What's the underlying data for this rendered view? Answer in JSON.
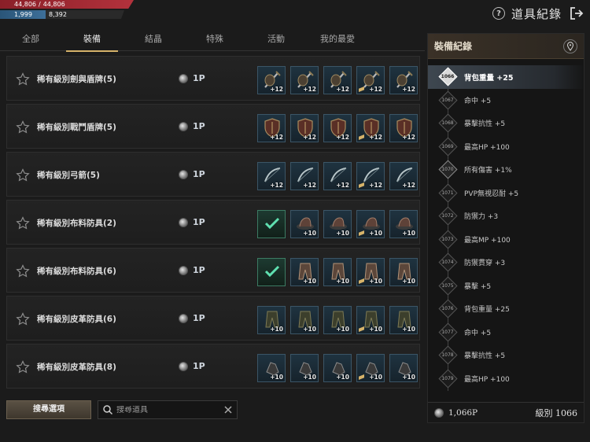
{
  "status": {
    "hp_current": "44,806",
    "hp_max": "44,806",
    "mp_current": "1,999",
    "mp_max": "8,392",
    "hp_color": "#b3323c",
    "mp_color": "#3d6f99",
    "mp_fill_fraction": 0.24
  },
  "header": {
    "title": "道具紀錄",
    "help_icon": "question-circle-icon",
    "exit_icon": "exit-icon"
  },
  "tabs": [
    {
      "label": "全部",
      "active": false
    },
    {
      "label": "裝備",
      "active": true
    },
    {
      "label": "結晶",
      "active": false
    },
    {
      "label": "特殊",
      "active": false
    },
    {
      "label": "活動",
      "active": false
    },
    {
      "label": "我的最愛",
      "active": false
    }
  ],
  "items": [
    {
      "name": "稀有級別劍與盾牌(5)",
      "points": "1P",
      "slot_type": "sword-shield",
      "slots": [
        "+12",
        "+12",
        "+12",
        "+12",
        "+12"
      ],
      "registered": [
        false,
        false,
        false,
        false,
        false
      ]
    },
    {
      "name": "稀有級別戰鬥盾牌(5)",
      "points": "1P",
      "slot_type": "shield",
      "slots": [
        "+12",
        "+12",
        "+12",
        "+12",
        "+12"
      ],
      "registered": [
        false,
        false,
        false,
        false,
        false
      ]
    },
    {
      "name": "稀有級別弓箭(5)",
      "points": "1P",
      "slot_type": "bow",
      "slots": [
        "+12",
        "+12",
        "+12",
        "+12",
        "+12"
      ],
      "registered": [
        false,
        false,
        false,
        false,
        false
      ]
    },
    {
      "name": "稀有級別布料防具(2)",
      "points": "1P",
      "slot_type": "hat",
      "slots": [
        "",
        "+10",
        "+10",
        "+10",
        "+10"
      ],
      "registered": [
        true,
        false,
        false,
        false,
        false
      ]
    },
    {
      "name": "稀有級別布料防具(6)",
      "points": "1P",
      "slot_type": "pants",
      "slots": [
        "",
        "+10",
        "+10",
        "+10",
        "+10"
      ],
      "registered": [
        true,
        false,
        false,
        false,
        false
      ]
    },
    {
      "name": "稀有級別皮革防具(6)",
      "points": "1P",
      "slot_type": "leather-pants",
      "slots": [
        "+10",
        "+10",
        "+10",
        "+10",
        "+10"
      ],
      "registered": [
        false,
        false,
        false,
        false,
        false
      ]
    },
    {
      "name": "稀有級別皮革防具(8)",
      "points": "1P",
      "slot_type": "gloves",
      "slots": [
        "+10",
        "+10",
        "+10",
        "+10",
        "+10"
      ],
      "registered": [
        false,
        false,
        false,
        false,
        false
      ]
    }
  ],
  "bottom": {
    "search_options_label": "搜尋選項",
    "search_placeholder": "搜尋道具"
  },
  "panel": {
    "title": "裝備紀錄",
    "records": [
      {
        "level": "1066",
        "text": "背包重量 +25",
        "current": true
      },
      {
        "level": "1067",
        "text": "命中 +5"
      },
      {
        "level": "1068",
        "text": "暴擊抗性 +5"
      },
      {
        "level": "1069",
        "text": "最高HP +100"
      },
      {
        "level": "1070",
        "text": "所有傷害 +1%",
        "milestone": true
      },
      {
        "level": "1071",
        "text": "PVP無視忍耐 +5"
      },
      {
        "level": "1072",
        "text": "防禦力 +3"
      },
      {
        "level": "1073",
        "text": "最高MP +100"
      },
      {
        "level": "1074",
        "text": "防禦貫穿 +3"
      },
      {
        "level": "1075",
        "text": "暴擊 +5"
      },
      {
        "level": "1076",
        "text": "背包重量 +25"
      },
      {
        "level": "1077",
        "text": "命中 +5"
      },
      {
        "level": "1078",
        "text": "暴擊抗性 +5"
      },
      {
        "level": "1079",
        "text": "最高HP +100"
      }
    ],
    "footer_points": "1,066P",
    "footer_level": "級別 1066"
  }
}
